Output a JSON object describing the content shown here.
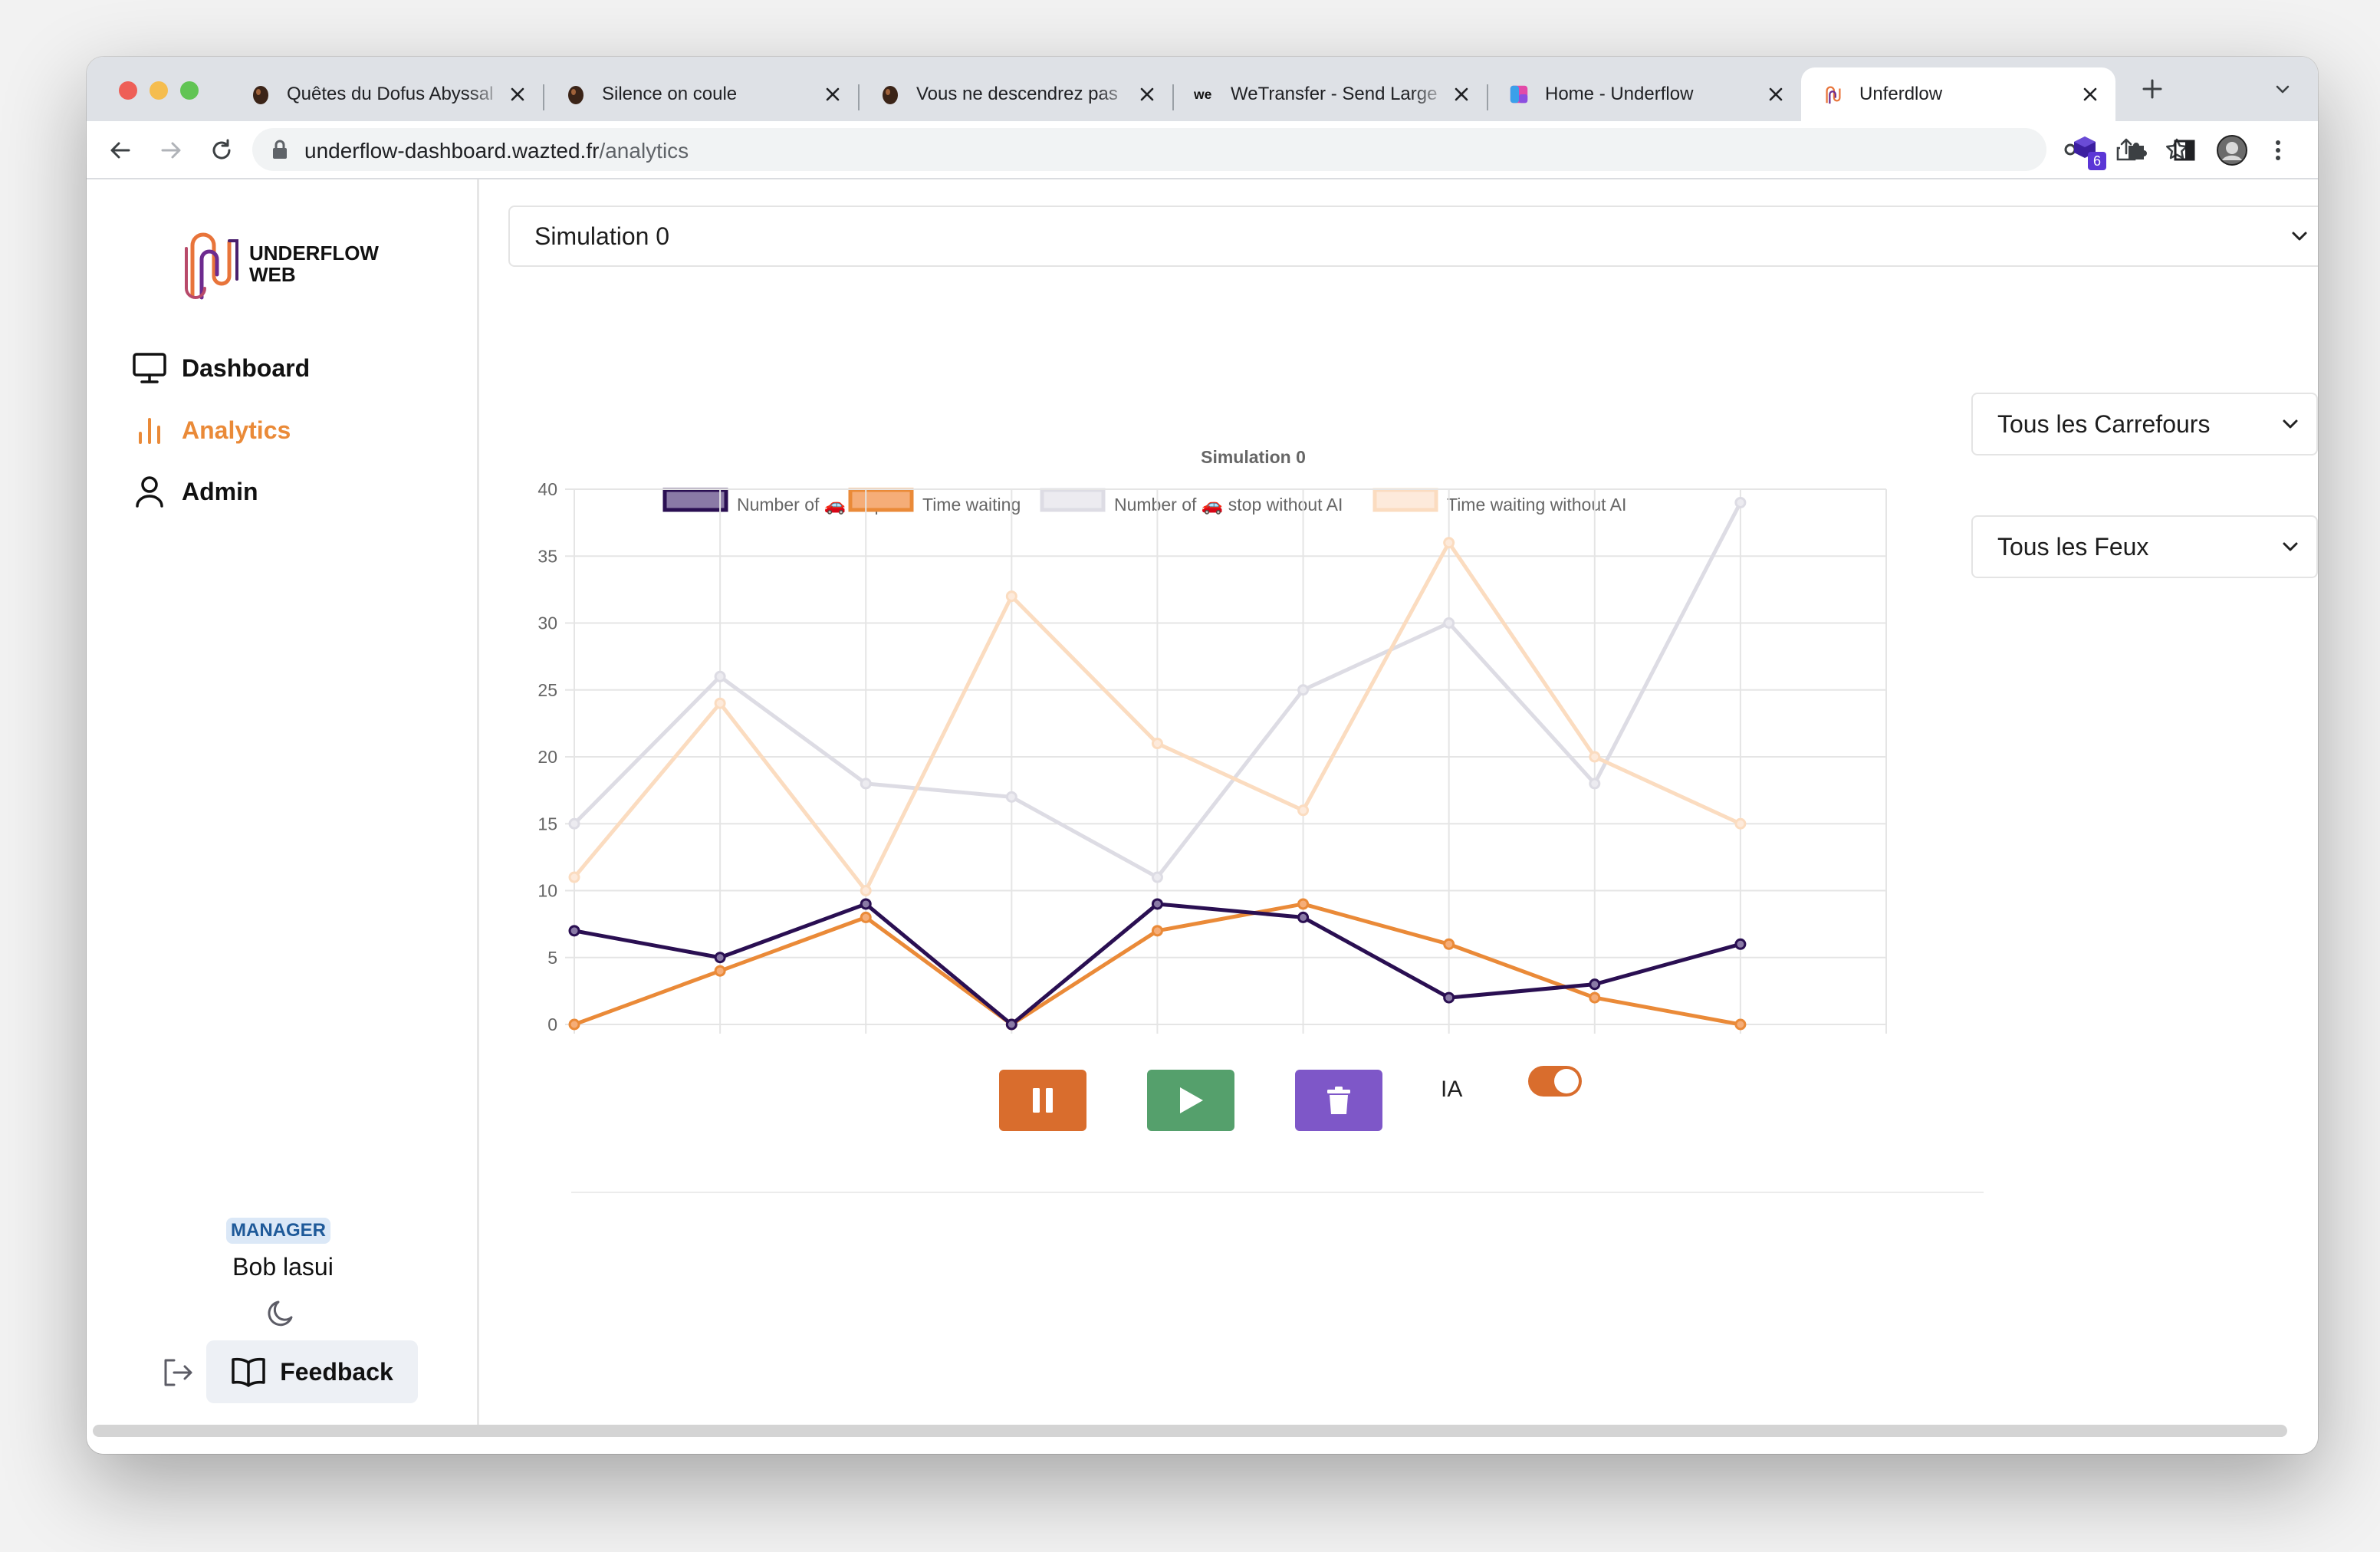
{
  "browser": {
    "tabs": [
      {
        "title": "Quêtes du Dofus Abyssal",
        "favicon": "dofus-egg-icon",
        "active": false
      },
      {
        "title": "Silence on coule",
        "favicon": "dofus-egg-icon",
        "active": false
      },
      {
        "title": "Vous ne descendrez pas",
        "favicon": "dofus-egg-icon",
        "active": false
      },
      {
        "title": "WeTransfer - Send Large",
        "favicon": "wetransfer-icon",
        "active": false
      },
      {
        "title": "Home - Underflow",
        "favicon": "underflow-cube-icon",
        "active": false
      },
      {
        "title": "Unferdlow",
        "favicon": "underflow-logo-icon",
        "active": true
      }
    ],
    "url_host": "underflow-dashboard.wazted.fr",
    "url_path": "/analytics",
    "extension_badge": "6"
  },
  "sidebar": {
    "logo_line1": "UNDERFLOW",
    "logo_line2": "WEB",
    "nav": [
      {
        "label": "Dashboard",
        "icon": "monitor-icon",
        "active": false
      },
      {
        "label": "Analytics",
        "icon": "bar-chart-icon",
        "active": true
      },
      {
        "label": "Admin",
        "icon": "user-icon",
        "active": false
      }
    ],
    "role_badge": "MANAGER",
    "user_name": "Bob lasui",
    "feedback_label": "Feedback"
  },
  "main": {
    "simulation_select": "Simulation 0",
    "crossroads_select": "Tous les Carrefours",
    "lights_select": "Tous les Feux",
    "ia_label": "IA",
    "ia_enabled": true
  },
  "colors": {
    "accent": "#ea8a38",
    "pause": "#d96d2d",
    "play": "#55a06c",
    "delete": "#7e57c8",
    "badge_bg": "#dbe8f7",
    "badge_text": "#1f5a99"
  },
  "chart_data": {
    "type": "line",
    "title": "Simulation 0",
    "x": [
      0,
      1,
      2,
      3,
      4,
      5,
      6,
      7,
      8
    ],
    "xlim": [
      0,
      9
    ],
    "ylim": [
      0,
      40
    ],
    "yticks": [
      0,
      5,
      10,
      15,
      20,
      25,
      30,
      35,
      40
    ],
    "xticks": [
      0,
      1,
      2,
      3,
      4,
      5,
      6,
      7,
      8,
      9
    ],
    "grid": true,
    "legend_position": "top",
    "series": [
      {
        "name": "Number of 🚗 stop",
        "color": "#2a0f52",
        "fill": "#8a7aa6",
        "values": [
          7,
          5,
          9,
          0,
          9,
          8,
          2,
          3,
          6
        ]
      },
      {
        "name": "Time waiting",
        "color": "#ea8a38",
        "fill": "#f5ad78",
        "values": [
          0,
          4,
          8,
          0,
          7,
          9,
          6,
          2,
          0
        ]
      },
      {
        "name": "Number of 🚗 stop without AI",
        "color": "#dddce4",
        "fill": "#ecebf0",
        "values": [
          15,
          26,
          18,
          17,
          11,
          25,
          30,
          18,
          39
        ]
      },
      {
        "name": "Time waiting without AI",
        "color": "#fbdcc0",
        "fill": "#fdeadb",
        "values": [
          11,
          24,
          10,
          32,
          21,
          16,
          36,
          20,
          15
        ]
      }
    ]
  }
}
